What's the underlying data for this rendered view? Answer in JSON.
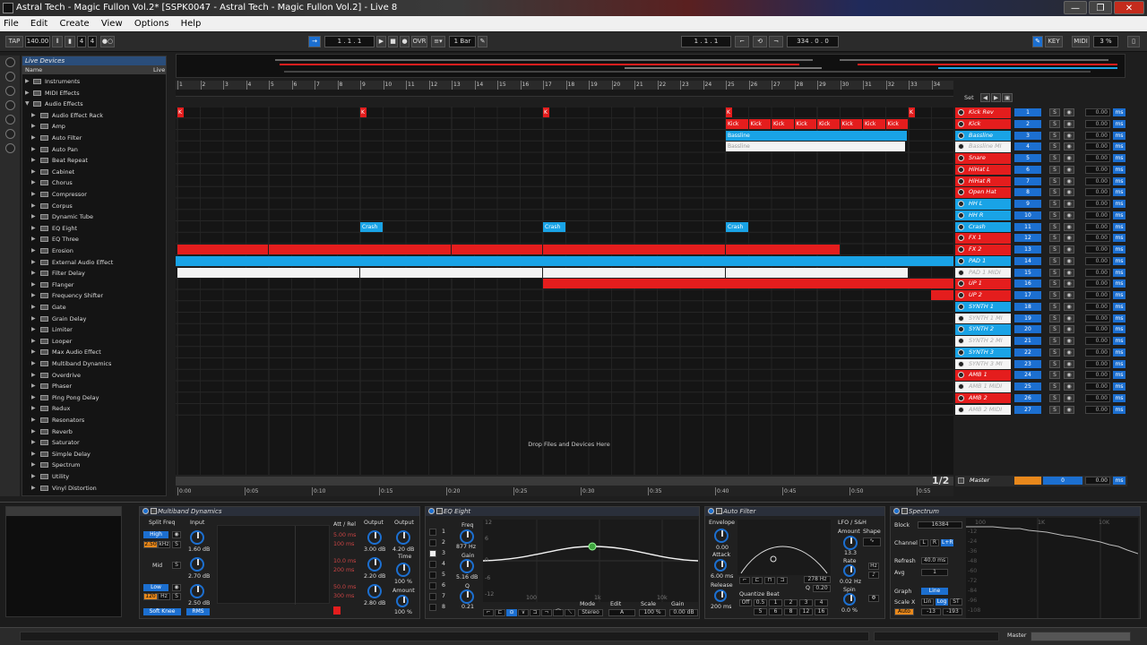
{
  "window": {
    "title": "Astral Tech - Magic Fullon Vol.2*  [SSPK0047 - Astral Tech - Magic Fullon Vol.2] - Live 8",
    "min": "—",
    "restore": "❐",
    "close": "✕"
  },
  "menu": [
    "File",
    "Edit",
    "Create",
    "View",
    "Options",
    "Help"
  ],
  "transport": {
    "tap": "TAP",
    "tempo": "140.00",
    "signature_num": "4",
    "signature_den": "4",
    "position": "1 .    1 .    1",
    "ovr": "OVR",
    "quantize": "1 Bar",
    "loop_start": "1 .    1 .    1",
    "loop_length": "334 .    0 .    0",
    "key": "KEY",
    "midi": "MIDI",
    "cpu": "3 %"
  },
  "browser": {
    "title": "Live Devices",
    "col_name": "Name",
    "col_live": "Live",
    "folders": [
      "Instruments",
      "MIDI Effects",
      "Audio Effects"
    ],
    "items": [
      "Audio Effect Rack",
      "Amp",
      "Auto Filter",
      "Auto Pan",
      "Beat Repeat",
      "Cabinet",
      "Chorus",
      "Compressor",
      "Corpus",
      "Dynamic Tube",
      "EQ Eight",
      "EQ Three",
      "Erosion",
      "External Audio Effect",
      "Filter Delay",
      "Flanger",
      "Frequency Shifter",
      "Gate",
      "Grain Delay",
      "Limiter",
      "Looper",
      "Max Audio Effect",
      "Multiband Dynamics",
      "Overdrive",
      "Phaser",
      "Ping Pong Delay",
      "Redux",
      "Resonators",
      "Reverb",
      "Saturator",
      "Simple Delay",
      "Spectrum",
      "Utility",
      "Vinyl Distortion"
    ]
  },
  "ruler": {
    "bars": [
      "1",
      "2",
      "3",
      "4",
      "5",
      "6",
      "7",
      "8",
      "9",
      "10",
      "11",
      "12",
      "13",
      "14",
      "15",
      "16",
      "17",
      "18",
      "19",
      "20",
      "21",
      "22",
      "23",
      "24",
      "25",
      "26",
      "27",
      "28",
      "29",
      "30",
      "31",
      "32",
      "33",
      "34"
    ],
    "set_label": "Set"
  },
  "clips": {
    "kick": "Kick",
    "bassline": "Bassline",
    "crash": "Crash",
    "marker": "K"
  },
  "drop_text": "Drop Files and Devices Here",
  "timeline": {
    "ticks": [
      "0:00",
      "0:05",
      "0:10",
      "0:15",
      "0:20",
      "0:25",
      "0:30",
      "0:35",
      "0:40",
      "0:45",
      "0:50",
      "0:55"
    ],
    "page": "1/2"
  },
  "tracks": [
    {
      "name": "Kick Rev",
      "num": "1",
      "color": "#e41d1d",
      "vol": "0.00"
    },
    {
      "name": "Kick",
      "num": "2",
      "color": "#e41d1d",
      "vol": "0.00"
    },
    {
      "name": "Bassline",
      "num": "3",
      "color": "#19a3e6",
      "vol": "0.00"
    },
    {
      "name": "Bassline MI",
      "num": "4",
      "color": "#f4f4f4",
      "vol": "0.00"
    },
    {
      "name": "Snare",
      "num": "5",
      "color": "#e41d1d",
      "vol": "0.00"
    },
    {
      "name": "HiHat L",
      "num": "6",
      "color": "#e41d1d",
      "vol": "0.00"
    },
    {
      "name": "HiHat R",
      "num": "7",
      "color": "#e41d1d",
      "vol": "0.00"
    },
    {
      "name": "Open Hat",
      "num": "8",
      "color": "#e41d1d",
      "vol": "0.00"
    },
    {
      "name": "HH L",
      "num": "9",
      "color": "#19a3e6",
      "vol": "0.00"
    },
    {
      "name": "HH R",
      "num": "10",
      "color": "#19a3e6",
      "vol": "0.00"
    },
    {
      "name": "Crash",
      "num": "11",
      "color": "#19a3e6",
      "vol": "0.00"
    },
    {
      "name": "FX 1",
      "num": "12",
      "color": "#e41d1d",
      "vol": "0.00"
    },
    {
      "name": "FX 2",
      "num": "13",
      "color": "#e41d1d",
      "vol": "0.00"
    },
    {
      "name": "PAD 1",
      "num": "14",
      "color": "#19a3e6",
      "vol": "0.00"
    },
    {
      "name": "PAD 1 MIDI",
      "num": "15",
      "color": "#f4f4f4",
      "vol": "0.00"
    },
    {
      "name": "UP 1",
      "num": "16",
      "color": "#e41d1d",
      "vol": "0.00"
    },
    {
      "name": "UP 2",
      "num": "17",
      "color": "#e41d1d",
      "vol": "0.00"
    },
    {
      "name": "SYNTH 1",
      "num": "18",
      "color": "#19a3e6",
      "vol": "0.00"
    },
    {
      "name": "SYNTH 1 MI",
      "num": "19",
      "color": "#f4f4f4",
      "vol": "0.00"
    },
    {
      "name": "SYNTH 2",
      "num": "20",
      "color": "#19a3e6",
      "vol": "0.00"
    },
    {
      "name": "SYNTH 2 MI",
      "num": "21",
      "color": "#f4f4f4",
      "vol": "0.00"
    },
    {
      "name": "SYNTH 3",
      "num": "22",
      "color": "#19a3e6",
      "vol": "0.00"
    },
    {
      "name": "SYNTH 3 MI",
      "num": "23",
      "color": "#f4f4f4",
      "vol": "0.00"
    },
    {
      "name": "AMB 1",
      "num": "24",
      "color": "#e41d1d",
      "vol": "0.00"
    },
    {
      "name": "AMB 1 MIDI",
      "num": "25",
      "color": "#f4f4f4",
      "vol": "0.00"
    },
    {
      "name": "AMB 2",
      "num": "26",
      "color": "#e41d1d",
      "vol": "0.00"
    },
    {
      "name": "AMB 2 MIDI",
      "num": "27",
      "color": "#f4f4f4",
      "vol": "0.00"
    }
  ],
  "master": {
    "name": "Master",
    "num": "0",
    "vol": "0.00",
    "ms": "ms"
  },
  "solo_label": "S",
  "ms_label": "ms",
  "devices": {
    "multiband": {
      "title": "Multiband Dynamics",
      "split_freq": "Split Freq",
      "input": "Input",
      "output": "Output",
      "high": "High",
      "mid": "Mid",
      "low": "Low",
      "khz": "kHz",
      "khz_val": "2.50",
      "hz": "Hz",
      "hz_val": "120",
      "in_high": "1.60 dB",
      "in_mid": "2.70 dB",
      "in_low": "2.50 dB",
      "out_high": "3.00 dB",
      "out_mid": "2.20 dB",
      "out_low": "2.80 dB",
      "out_main": "4.20 dB",
      "time_label": "Time",
      "time_val": "100 %",
      "amount_label": "Amount",
      "amount_val": "100 %",
      "att_rel": "Att / Rel",
      "ms_vals": [
        "5.00 ms",
        "100 ms",
        "10.0 ms",
        "200 ms",
        "50.0 ms",
        "300 ms"
      ],
      "soft_knee": "Soft Knee",
      "rms": "RMS",
      "scale": [
        "80",
        "70",
        "60",
        "50",
        "40",
        "30",
        "20",
        "10",
        "0"
      ],
      "s": "S"
    },
    "eq": {
      "title": "EQ Eight",
      "bands": [
        "1",
        "2",
        "3",
        "4",
        "5",
        "6",
        "7",
        "8"
      ],
      "freq_label": "Freq",
      "freq_val": "877 Hz",
      "gain_label": "Gain",
      "gain_val": "5.16 dB",
      "q_label": "Q",
      "q_val": "0.21",
      "db_ticks": [
        "12",
        "6",
        "0",
        "-6",
        "-12"
      ],
      "freq_ticks": [
        "100",
        "1k",
        "10k"
      ],
      "mode_label": "Mode",
      "mode_val": "Stereo",
      "edit_label": "Edit",
      "edit_val": "A",
      "scale_label": "Scale",
      "scale_val": "100 %",
      "gain2_label": "Gain",
      "gain2_val": "0.00 dB"
    },
    "autofilter": {
      "title": "Auto Filter",
      "envelope": "Envelope",
      "env_val": "0.00",
      "attack_label": "Attack",
      "attack_val": "6.00 ms",
      "release_label": "Release",
      "release_val": "200 ms",
      "freq": "278 Hz",
      "q_label": "Q",
      "q_val": "0.20",
      "quantize": "Quantize Beat",
      "qbeats": [
        "0.5",
        "1",
        "2",
        "3",
        "4",
        "5",
        "6",
        "8",
        "12",
        "16"
      ],
      "lfo": "LFO / S&H",
      "amount_label": "Amount",
      "amount_val": "13.3",
      "shape_label": "Shape",
      "rate_label": "Rate",
      "rate_val": "0.02 Hz",
      "spin_label": "Spin",
      "spin_val": "0.0 %",
      "hz": "Hz",
      "off": "Off"
    },
    "spectrum": {
      "title": "Spectrum",
      "block_label": "Block",
      "block_val": "16384",
      "channel_label": "Channel",
      "ch_l": "L",
      "ch_r": "R",
      "ch_lr": "L+R",
      "refresh_label": "Refresh",
      "refresh_val": "40.0 ms",
      "avg_label": "Avg",
      "avg_val": "1",
      "graph_label": "Graph",
      "graph_val": "Line",
      "scalex_label": "Scale X",
      "lin": "Lin",
      "log": "Log",
      "st": "ST",
      "auto": "Auto",
      "range_lo": "-13",
      "range_hi": "-193",
      "db_ticks": [
        "-12",
        "-24",
        "-36",
        "-48",
        "-60",
        "-72",
        "-84",
        "-96",
        "-108"
      ],
      "freq_ticks": [
        "100",
        "1K",
        "10K"
      ]
    }
  },
  "status": {
    "master_label": "Master"
  }
}
